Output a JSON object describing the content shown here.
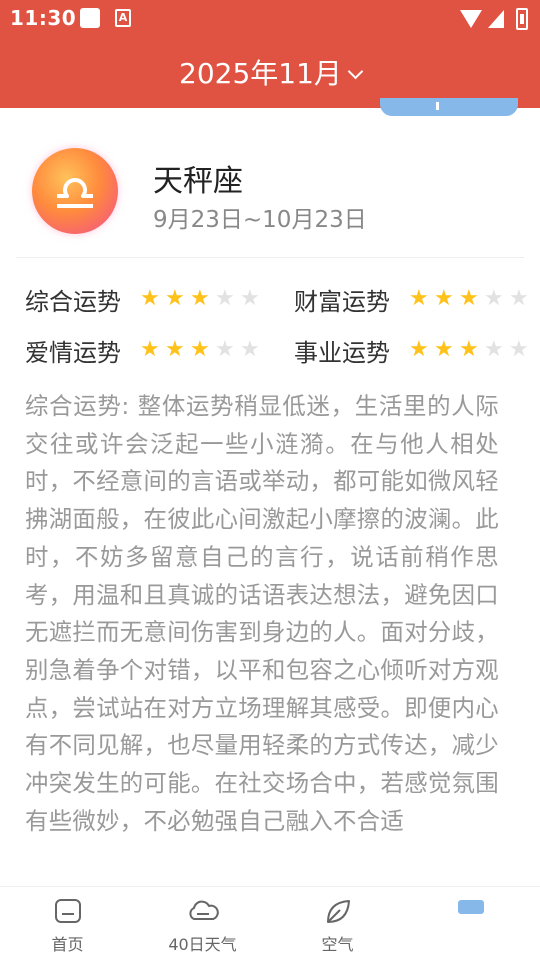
{
  "status": {
    "time": "11:30",
    "notif_badge": "A"
  },
  "header": {
    "title": "2025年11月"
  },
  "sign": {
    "name": "天秤座",
    "date_range": "9月23日~10月23日",
    "icon": "libra-symbol-icon"
  },
  "ratings": [
    {
      "label": "综合运势",
      "stars": 3,
      "max": 5
    },
    {
      "label": "财富运势",
      "stars": 3,
      "max": 5
    },
    {
      "label": "爱情运势",
      "stars": 3,
      "max": 5
    },
    {
      "label": "事业运势",
      "stars": 3,
      "max": 5
    }
  ],
  "description": "综合运势: 整体运势稍显低迷，生活里的人际交往或许会泛起一些小涟漪。在与他人相处时，不经意间的言语或举动，都可能如微风轻拂湖面般，在彼此心间激起小摩擦的波澜。此时，不妨多留意自己的言行，说话前稍作思考，用温和且真诚的话语表达想法，避免因口无遮拦而无意间伤害到身边的人。面对分歧，别急着争个对错，以平和包容之心倾听对方观点，尝试站在对方立场理解其感受。即便内心有不同见解，也尽量用轻柔的方式传达，减少冲突发生的可能。在社交场合中，若感觉氛围有些微妙，不必勉强自己融入不合适",
  "nav": [
    {
      "label": "首页",
      "icon": "home-icon"
    },
    {
      "label": "40日天气",
      "icon": "cloud-icon"
    },
    {
      "label": "空气",
      "icon": "leaf-icon"
    },
    {
      "label": "",
      "icon": "horoscope-tab-icon"
    }
  ],
  "colors": {
    "header_bg": "#e05241",
    "star_on": "#ffc21a",
    "star_off": "#e2e2e2",
    "accent_blue": "#86b8ea"
  }
}
